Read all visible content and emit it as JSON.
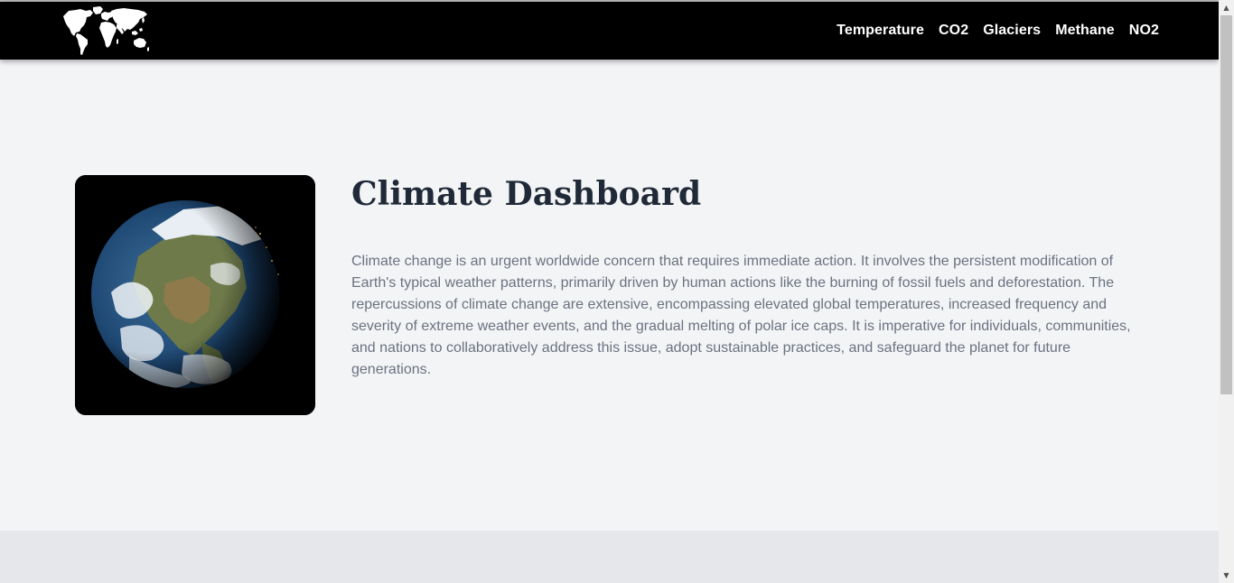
{
  "navbar": {
    "logo_icon": "world-map-icon",
    "links": [
      {
        "label": "Temperature"
      },
      {
        "label": "CO2"
      },
      {
        "label": "Glaciers"
      },
      {
        "label": "Methane"
      },
      {
        "label": "NO2"
      }
    ],
    "background": "#000000",
    "link_color": "#ffffff"
  },
  "hero": {
    "title": "Climate Dashboard",
    "description": "Climate change is an urgent worldwide concern that requires immediate action. It involves the persistent modification of Earth's typical weather patterns, primarily driven by human actions like the burning of fossil fuels and deforestation. The repercussions of climate change are extensive, encompassing elevated global temperatures, increased frequency and severity of extreme weather events, and the gradual melting of polar ice caps. It is imperative for individuals, communities, and nations to collaboratively address this issue, adopt sustainable practices, and safeguard the planet for future generations.",
    "image_icon": "earth-globe-icon",
    "title_color": "#1f2937",
    "text_color": "#6b7280"
  },
  "scrollbar": {
    "up_icon": "scroll-up-arrow-icon",
    "down_icon": "scroll-down-arrow-icon"
  },
  "colors": {
    "page_background": "#f3f4f6",
    "section_background": "#e5e7eb"
  }
}
